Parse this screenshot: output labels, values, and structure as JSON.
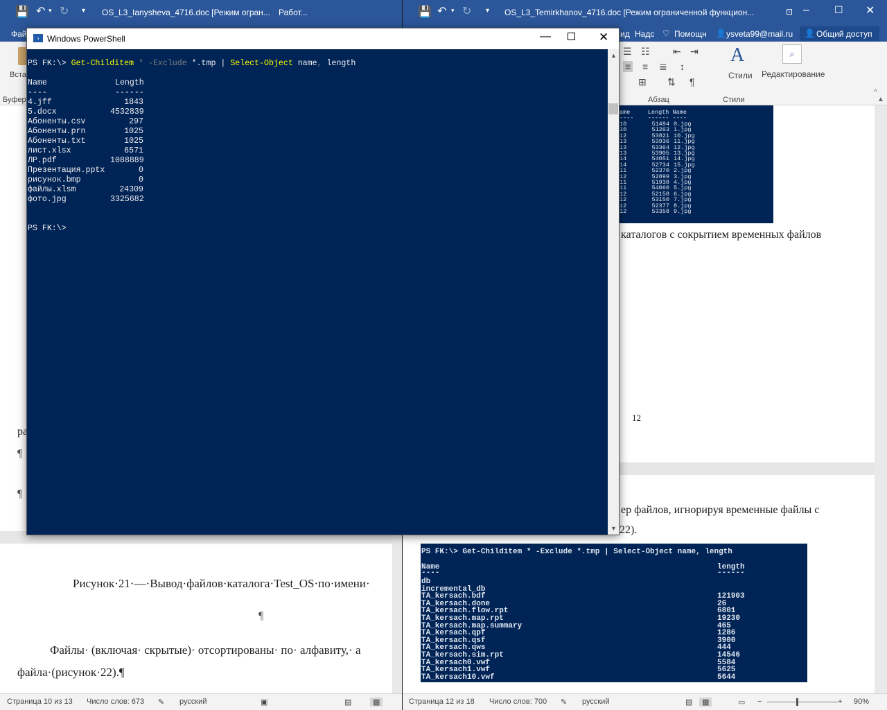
{
  "left_word": {
    "title": "OS_L3_Ianysheva_4716.doc [Режим огран...",
    "title_tail": "Работ...",
    "tab_file": "Фай",
    "ribbon_paste": "Вста",
    "ribbon_group_buffer": "Буфер",
    "doc_line_1": "ра",
    "doc_pilcrow_1": "¶",
    "doc_pilcrow_2": "¶",
    "caption": "Рисунок·21·—·Вывод·файлов·каталога·Test_OS·по·имени·",
    "caption_pilcrow": "¶",
    "para_line_1": "Файлы· (включая· скрытые)· отсортированы· по· алфавиту,· а",
    "para_line_2": "файла·(рисунок·22).¶",
    "status_page": "Страница 10 из 13",
    "status_words": "Число слов: 673",
    "status_lang": "русский"
  },
  "right_word": {
    "title": "OS_L3_Temirkhanov_4716.doc [Режим ограниченной функцион...",
    "tab_view": "ид",
    "tab_addins": "Надс",
    "help": "Помощн",
    "user_email": "ysveta99@mail.ru",
    "share": "Общий доступ",
    "styles_label": "Стили",
    "editing_label": "Редактирование",
    "group_paragraph": "Абзац",
    "group_styles": "Стили",
    "doc_text_1": "каталогов с сокрытием временных файлов",
    "page_number": "12",
    "doc_text_2": "ер  файлов,  игнорируя  временные  файлы  с",
    "doc_text_3": "22).",
    "status_page": "Страница 12 из 18",
    "status_words": "Число слов: 700",
    "status_lang": "русский",
    "zoom": "90%",
    "img1_header": "ame     Length Name",
    "img1_header_sep": "----    ------ ----",
    "img1_rows": [
      [
        "10",
        "51494",
        "0.jpg"
      ],
      [
        "10",
        "51263",
        "1.jpg"
      ],
      [
        "12",
        "53821",
        "10.jpg"
      ],
      [
        "13",
        "53936",
        "11.jpg"
      ],
      [
        "13",
        "53364",
        "12.jpg"
      ],
      [
        "13",
        "53905",
        "13.jpg"
      ],
      [
        "14",
        "54051",
        "14.jpg"
      ],
      [
        "14",
        "52734",
        "15.jpg"
      ],
      [
        "11",
        "52370",
        "2.jpg"
      ],
      [
        "12",
        "52899",
        "3.jpg"
      ],
      [
        "11",
        "51938",
        "4.jpg"
      ],
      [
        "11",
        "54060",
        "5.jpg"
      ],
      [
        "12",
        "52158",
        "6.jpg"
      ],
      [
        "12",
        "53150",
        "7.jpg"
      ],
      [
        "12",
        "52377",
        "8.jpg"
      ],
      [
        "12",
        "53358",
        "9.jpg"
      ]
    ],
    "img2_command": "PS FK:\\> Get-Childitem * -Exclude *.tmp | Select-Object name, length",
    "img2_col_name": "Name",
    "img2_col_length": "length",
    "img2_sep_name": "----",
    "img2_sep_length": "------",
    "img2_rows": [
      [
        "db",
        ""
      ],
      [
        "incremental_db",
        ""
      ],
      [
        "TA_kersach.bdf",
        "121903"
      ],
      [
        "TA_kersach.done",
        "26"
      ],
      [
        "TA_kersach.flow.rpt",
        "6801"
      ],
      [
        "TA_kersach.map.rpt",
        "19230"
      ],
      [
        "TA_kersach.map.summary",
        "465"
      ],
      [
        "TA_kersach.qpf",
        "1286"
      ],
      [
        "TA_kersach.qsf",
        "3900"
      ],
      [
        "TA_kersach.qws",
        "444"
      ],
      [
        "TA_kersach.sim.rpt",
        "14546"
      ],
      [
        "TA_kersach0.vwf",
        "5584"
      ],
      [
        "TA_kersach1.vwf",
        "5625"
      ],
      [
        "TA_kersach10.vwf",
        "5644"
      ]
    ]
  },
  "powershell": {
    "title": "Windows PowerShell",
    "prompt": "PS FK:\\>",
    "cmd_get": "Get-Childitem",
    "cmd_star": "*",
    "cmd_exclude": "-Exclude",
    "cmd_pattern": "*.tmp",
    "cmd_pipe": "|",
    "cmd_select": "Select-Object",
    "cmd_args": "name",
    "cmd_comma": ",",
    "cmd_args2": "length",
    "col_name": "Name",
    "col_length": "Length",
    "sep_name": "----",
    "sep_length": "------",
    "rows": [
      {
        "name": "4.jff",
        "length": "1843"
      },
      {
        "name": "5.docx",
        "length": "4532839"
      },
      {
        "name": "Абоненты.csv",
        "length": "297"
      },
      {
        "name": "Абоненты.prn",
        "length": "1025"
      },
      {
        "name": "Абоненты.txt",
        "length": "1025"
      },
      {
        "name": "лист.xlsx",
        "length": "6571"
      },
      {
        "name": "ЛР.pdf",
        "length": "1088889"
      },
      {
        "name": "Презентация.pptx",
        "length": "0"
      },
      {
        "name": "рисунок.bmp",
        "length": "0"
      },
      {
        "name": "файлы.xlsm",
        "length": "24309"
      },
      {
        "name": "фото.jpg",
        "length": "3325682"
      }
    ],
    "final_prompt": "PS FK:\\>"
  },
  "colors": {
    "word_blue": "#2b579a",
    "ps_bg": "#012456",
    "ps_yellow": "#ffff00"
  }
}
